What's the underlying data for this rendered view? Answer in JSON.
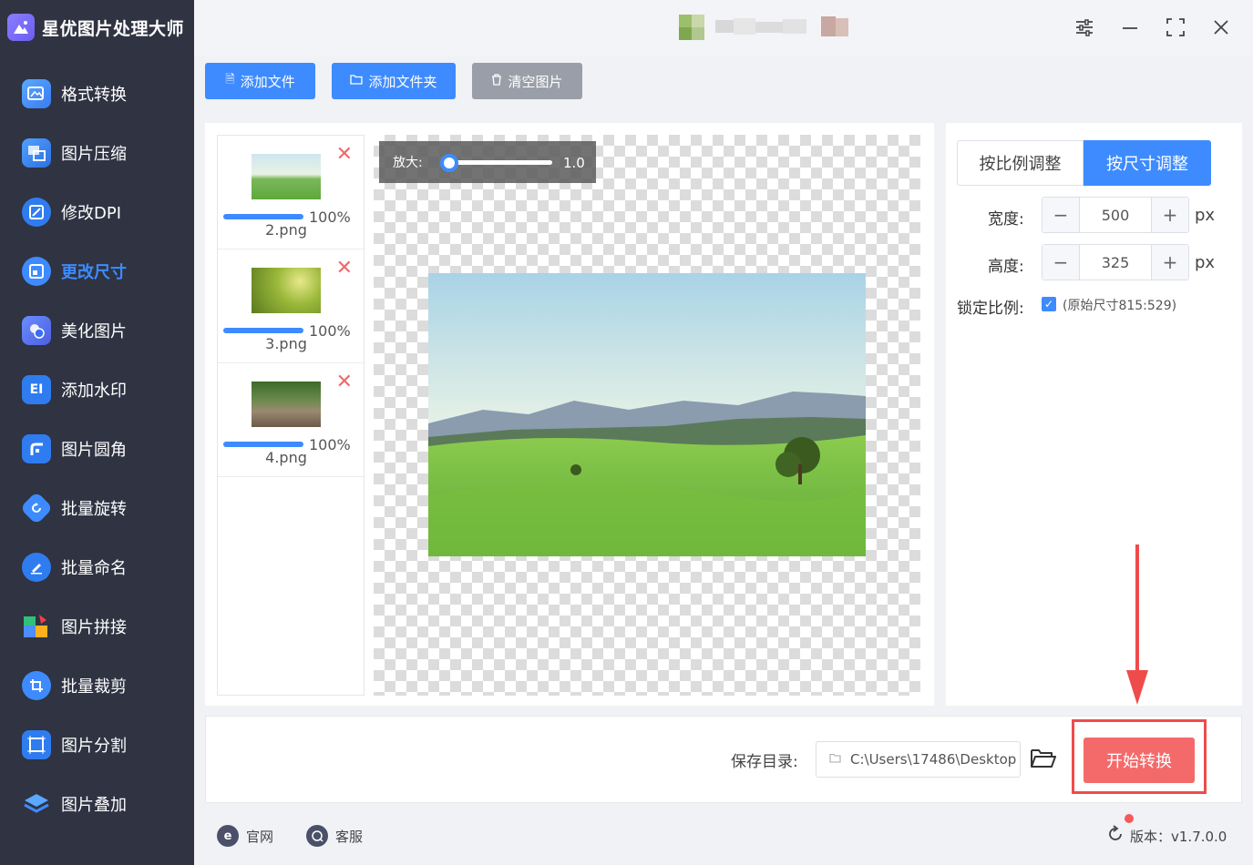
{
  "app": {
    "title": "星优图片处理大师"
  },
  "sidebar": {
    "items": [
      {
        "label": "格式转换",
        "icon": "image-convert-icon",
        "active": false
      },
      {
        "label": "图片压缩",
        "icon": "image-compress-icon",
        "active": false
      },
      {
        "label": "修改DPI",
        "icon": "dpi-icon",
        "active": false
      },
      {
        "label": "更改尺寸",
        "icon": "resize-icon",
        "active": true
      },
      {
        "label": "美化图片",
        "icon": "beautify-icon",
        "active": false
      },
      {
        "label": "添加水印",
        "icon": "watermark-icon",
        "active": false
      },
      {
        "label": "图片圆角",
        "icon": "rounded-corner-icon",
        "active": false
      },
      {
        "label": "批量旋转",
        "icon": "rotate-icon",
        "active": false
      },
      {
        "label": "批量命名",
        "icon": "rename-icon",
        "active": false
      },
      {
        "label": "图片拼接",
        "icon": "puzzle-icon",
        "active": false
      },
      {
        "label": "批量裁剪",
        "icon": "crop-icon",
        "active": false
      },
      {
        "label": "图片分割",
        "icon": "split-icon",
        "active": false
      },
      {
        "label": "图片叠加",
        "icon": "layers-icon",
        "active": false
      }
    ]
  },
  "toolbar": {
    "add_file": "添加文件",
    "add_folder": "添加文件夹",
    "clear": "清空图片"
  },
  "files": [
    {
      "name": "2.png",
      "progress": "100%"
    },
    {
      "name": "3.png",
      "progress": "100%"
    },
    {
      "name": "4.png",
      "progress": "100%"
    }
  ],
  "zoom": {
    "label": "放大:",
    "value": "1.0"
  },
  "resize": {
    "tab_ratio": "按比例调整",
    "tab_size": "按尺寸调整",
    "width_label": "宽度:",
    "width_value": "500",
    "height_label": "高度:",
    "height_value": "325",
    "unit": "px",
    "lock_label": "锁定比例:",
    "lock_checked": true,
    "original_size": "(原始尺寸815:529)"
  },
  "output": {
    "save_label": "保存目录:",
    "path": "C:\\Users\\17486\\Desktop",
    "start": "开始转换"
  },
  "footer": {
    "website": "官网",
    "support": "客服",
    "version": "版本：v1.7.0.0"
  },
  "colors": {
    "sidebar_bg": "#2f3342",
    "accent": "#3d8bff",
    "start_button": "#f46a6a",
    "highlight": "#f04b4b"
  }
}
